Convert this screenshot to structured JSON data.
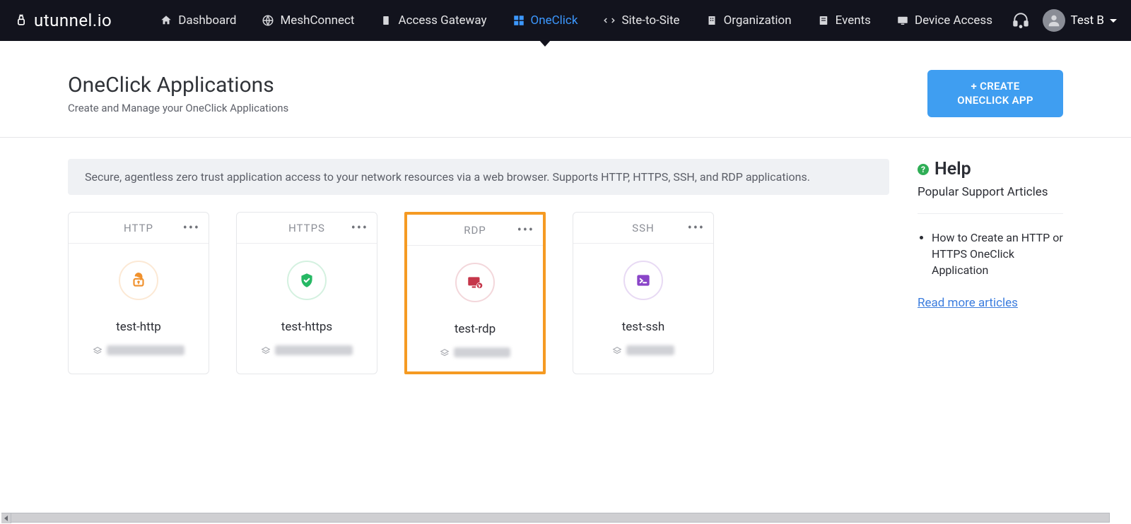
{
  "brand": {
    "name": "utunnel.io"
  },
  "nav": {
    "items": [
      {
        "label": "Dashboard",
        "icon": "home-icon"
      },
      {
        "label": "MeshConnect",
        "icon": "mesh-icon"
      },
      {
        "label": "Access Gateway",
        "icon": "gateway-icon"
      },
      {
        "label": "OneClick",
        "icon": "grid-icon",
        "active": true
      },
      {
        "label": "Site-to-Site",
        "icon": "site-to-site-icon"
      },
      {
        "label": "Organization",
        "icon": "org-icon"
      },
      {
        "label": "Events",
        "icon": "events-icon"
      },
      {
        "label": "Device Access",
        "icon": "device-icon"
      }
    ]
  },
  "user": {
    "name": "Test B"
  },
  "header": {
    "title": "OneClick Applications",
    "subtitle": "Create and Manage your OneClick Applications",
    "create_label": "+ CREATE ONECLICK APP"
  },
  "info_text": "Secure, agentless zero trust application access to your network resources via a web browser. Supports HTTP, HTTPS, SSH, and RDP applications.",
  "apps": [
    {
      "proto": "HTTP",
      "name": "test-http",
      "addr_width": 110,
      "icon_color": "#f0912d",
      "icon_type": "lock-open"
    },
    {
      "proto": "HTTPS",
      "name": "test-https",
      "addr_width": 110,
      "icon_color": "#26b864",
      "icon_type": "shield-check"
    },
    {
      "proto": "RDP",
      "name": "test-rdp",
      "addr_width": 80,
      "icon_color": "#c5364a",
      "icon_type": "monitor",
      "highlight": true
    },
    {
      "proto": "SSH",
      "name": "test-ssh",
      "addr_width": 68,
      "icon_color": "#8a45c8",
      "icon_type": "terminal"
    }
  ],
  "help": {
    "title": "Help",
    "subtitle": "Popular Support Articles",
    "articles": [
      "How to Create an HTTP or HTTPS OneClick Application"
    ],
    "read_more": "Read more articles"
  }
}
